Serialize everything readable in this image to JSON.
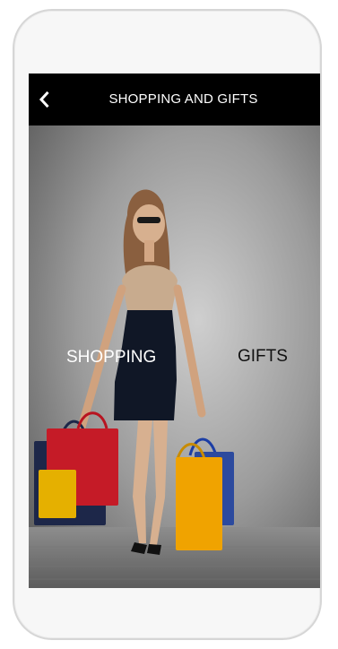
{
  "header": {
    "title": "SHOPPING AND GIFTS",
    "back_icon": "chevron-left-icon"
  },
  "menu": {
    "shopping_label": "SHOPPING",
    "gifts_label": "GIFTS"
  },
  "photo": {
    "subject": "woman holding shopping bags"
  },
  "colors": {
    "header_bg": "#000000",
    "header_text": "#ffffff",
    "shopping_text": "#ffffff",
    "gifts_text": "#111111"
  }
}
